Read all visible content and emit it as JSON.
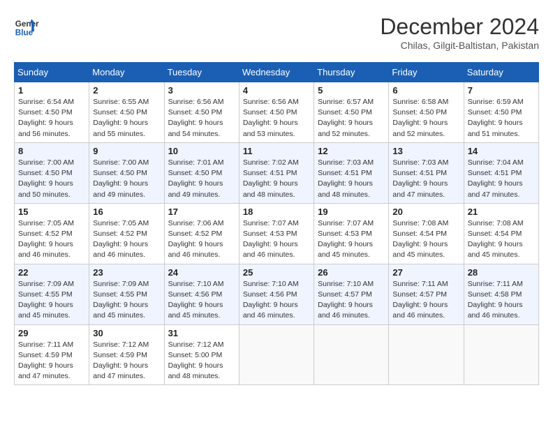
{
  "header": {
    "logo_line1": "General",
    "logo_line2": "Blue",
    "month_title": "December 2024",
    "subtitle": "Chilas, Gilgit-Baltistan, Pakistan"
  },
  "weekdays": [
    "Sunday",
    "Monday",
    "Tuesday",
    "Wednesday",
    "Thursday",
    "Friday",
    "Saturday"
  ],
  "weeks": [
    [
      {
        "day": "1",
        "sunrise": "6:54 AM",
        "sunset": "4:50 PM",
        "daylight": "9 hours and 56 minutes."
      },
      {
        "day": "2",
        "sunrise": "6:55 AM",
        "sunset": "4:50 PM",
        "daylight": "9 hours and 55 minutes."
      },
      {
        "day": "3",
        "sunrise": "6:56 AM",
        "sunset": "4:50 PM",
        "daylight": "9 hours and 54 minutes."
      },
      {
        "day": "4",
        "sunrise": "6:56 AM",
        "sunset": "4:50 PM",
        "daylight": "9 hours and 53 minutes."
      },
      {
        "day": "5",
        "sunrise": "6:57 AM",
        "sunset": "4:50 PM",
        "daylight": "9 hours and 52 minutes."
      },
      {
        "day": "6",
        "sunrise": "6:58 AM",
        "sunset": "4:50 PM",
        "daylight": "9 hours and 52 minutes."
      },
      {
        "day": "7",
        "sunrise": "6:59 AM",
        "sunset": "4:50 PM",
        "daylight": "9 hours and 51 minutes."
      }
    ],
    [
      {
        "day": "8",
        "sunrise": "7:00 AM",
        "sunset": "4:50 PM",
        "daylight": "9 hours and 50 minutes."
      },
      {
        "day": "9",
        "sunrise": "7:00 AM",
        "sunset": "4:50 PM",
        "daylight": "9 hours and 49 minutes."
      },
      {
        "day": "10",
        "sunrise": "7:01 AM",
        "sunset": "4:50 PM",
        "daylight": "9 hours and 49 minutes."
      },
      {
        "day": "11",
        "sunrise": "7:02 AM",
        "sunset": "4:51 PM",
        "daylight": "9 hours and 48 minutes."
      },
      {
        "day": "12",
        "sunrise": "7:03 AM",
        "sunset": "4:51 PM",
        "daylight": "9 hours and 48 minutes."
      },
      {
        "day": "13",
        "sunrise": "7:03 AM",
        "sunset": "4:51 PM",
        "daylight": "9 hours and 47 minutes."
      },
      {
        "day": "14",
        "sunrise": "7:04 AM",
        "sunset": "4:51 PM",
        "daylight": "9 hours and 47 minutes."
      }
    ],
    [
      {
        "day": "15",
        "sunrise": "7:05 AM",
        "sunset": "4:52 PM",
        "daylight": "9 hours and 46 minutes."
      },
      {
        "day": "16",
        "sunrise": "7:05 AM",
        "sunset": "4:52 PM",
        "daylight": "9 hours and 46 minutes."
      },
      {
        "day": "17",
        "sunrise": "7:06 AM",
        "sunset": "4:52 PM",
        "daylight": "9 hours and 46 minutes."
      },
      {
        "day": "18",
        "sunrise": "7:07 AM",
        "sunset": "4:53 PM",
        "daylight": "9 hours and 46 minutes."
      },
      {
        "day": "19",
        "sunrise": "7:07 AM",
        "sunset": "4:53 PM",
        "daylight": "9 hours and 45 minutes."
      },
      {
        "day": "20",
        "sunrise": "7:08 AM",
        "sunset": "4:54 PM",
        "daylight": "9 hours and 45 minutes."
      },
      {
        "day": "21",
        "sunrise": "7:08 AM",
        "sunset": "4:54 PM",
        "daylight": "9 hours and 45 minutes."
      }
    ],
    [
      {
        "day": "22",
        "sunrise": "7:09 AM",
        "sunset": "4:55 PM",
        "daylight": "9 hours and 45 minutes."
      },
      {
        "day": "23",
        "sunrise": "7:09 AM",
        "sunset": "4:55 PM",
        "daylight": "9 hours and 45 minutes."
      },
      {
        "day": "24",
        "sunrise": "7:10 AM",
        "sunset": "4:56 PM",
        "daylight": "9 hours and 45 minutes."
      },
      {
        "day": "25",
        "sunrise": "7:10 AM",
        "sunset": "4:56 PM",
        "daylight": "9 hours and 46 minutes."
      },
      {
        "day": "26",
        "sunrise": "7:10 AM",
        "sunset": "4:57 PM",
        "daylight": "9 hours and 46 minutes."
      },
      {
        "day": "27",
        "sunrise": "7:11 AM",
        "sunset": "4:57 PM",
        "daylight": "9 hours and 46 minutes."
      },
      {
        "day": "28",
        "sunrise": "7:11 AM",
        "sunset": "4:58 PM",
        "daylight": "9 hours and 46 minutes."
      }
    ],
    [
      {
        "day": "29",
        "sunrise": "7:11 AM",
        "sunset": "4:59 PM",
        "daylight": "9 hours and 47 minutes."
      },
      {
        "day": "30",
        "sunrise": "7:12 AM",
        "sunset": "4:59 PM",
        "daylight": "9 hours and 47 minutes."
      },
      {
        "day": "31",
        "sunrise": "7:12 AM",
        "sunset": "5:00 PM",
        "daylight": "9 hours and 48 minutes."
      },
      null,
      null,
      null,
      null
    ]
  ]
}
